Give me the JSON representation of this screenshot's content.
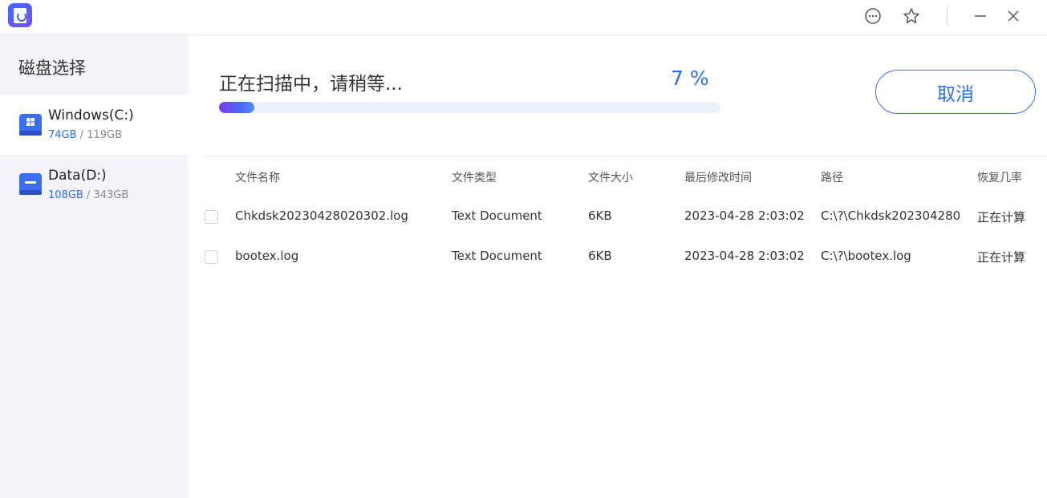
{
  "sidebar": {
    "title": "磁盘选择",
    "disks": [
      {
        "name": "Windows(C:)",
        "used": "74GB",
        "sep": " / ",
        "total": "119GB",
        "icon": "windows-drive-icon"
      },
      {
        "name": "Data(D:)",
        "used": "108GB",
        "sep": " / ",
        "total": "343GB",
        "icon": "drive-icon"
      }
    ]
  },
  "scan": {
    "title": "正在扫描中，请稍等...",
    "percent_label": "7 %",
    "progress": 0.07,
    "cancel_label": "取消"
  },
  "table": {
    "headers": [
      "文件名称",
      "文件类型",
      "文件大小",
      "最后修改时间",
      "路径",
      "恢复几率"
    ],
    "rows": [
      [
        "Chkdsk20230428020302.log",
        "Text Document",
        "6KB",
        "2023-04-28 2:03:02",
        "C:\\?\\Chkdsk202304280…",
        "正在计算"
      ],
      [
        "bootex.log",
        "Text Document",
        "6KB",
        "2023-04-28 2:03:02",
        "C:\\?\\bootex.log",
        "正在计算"
      ]
    ]
  },
  "colors": {
    "accent": "#2f6fe8",
    "sidebar_bg": "#f3f5f9"
  }
}
